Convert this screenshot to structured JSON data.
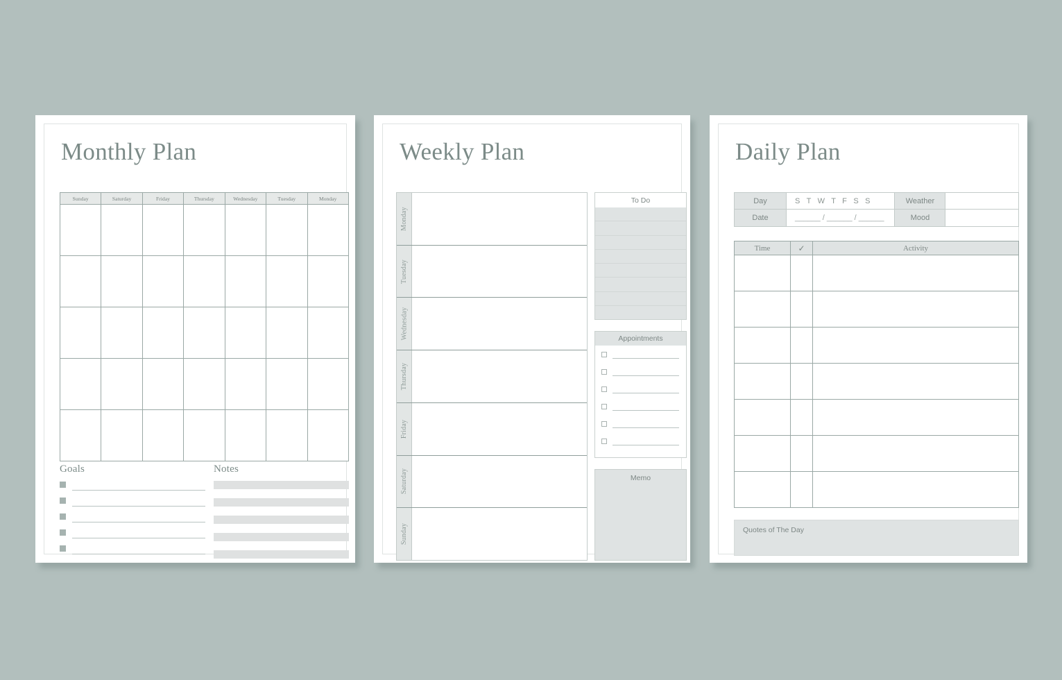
{
  "page": {
    "background_color": "#b2bfbd",
    "card_color": "#ffffff",
    "accent_color": "#7c8b88",
    "panel_gray": "#dfe3e3",
    "line_color": "#9aa8a5"
  },
  "monthly": {
    "title": "Monthly Plan",
    "weekday_headers": [
      "Sunday",
      "Saturday",
      "Friday",
      "Thursday",
      "Wednesday",
      "Tuesday",
      "Monday"
    ],
    "body_rows": 5,
    "goals": {
      "title": "Goals",
      "rows": 5
    },
    "notes": {
      "title": "Notes",
      "rows": 5
    }
  },
  "weekly": {
    "title": "Weekly Plan",
    "days": [
      "Monday",
      "Tuesday",
      "Wednesday",
      "Thursday",
      "Friday",
      "Saturday",
      "Sunday"
    ],
    "todo": {
      "title": "To Do",
      "lines": 8
    },
    "appointments": {
      "title": "Appointments",
      "rows": 6
    },
    "memo": {
      "title": "Memo"
    }
  },
  "daily": {
    "title": "Daily Plan",
    "info": {
      "day_label": "Day",
      "day_value": "S T W T F S S",
      "date_label": "Date",
      "date_value": "______ / ______ / ______",
      "weather_label": "Weather",
      "weather_value": "",
      "mood_label": "Mood",
      "mood_value": ""
    },
    "activity_table": {
      "headers": {
        "time": "Time",
        "check": "✓",
        "activity": "Activity"
      },
      "rows": 7
    },
    "quotes": {
      "title": "Quotes of The Day"
    }
  }
}
